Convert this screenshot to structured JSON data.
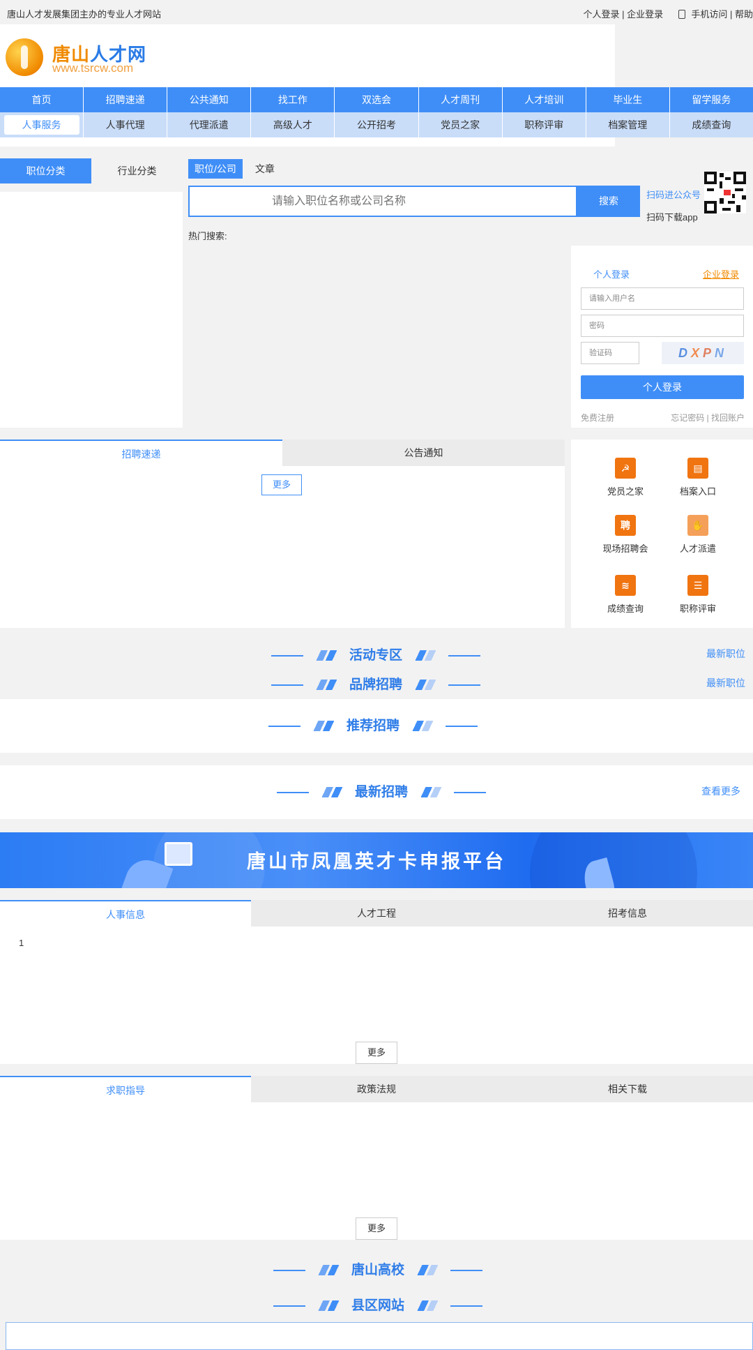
{
  "topbar": {
    "slogan": "唐山人才发展集团主办的专业人才网站",
    "links": "个人登录 | 企业登录",
    "mobile": "手机访问 | 帮助"
  },
  "logo": {
    "name_orange": "唐山",
    "name_blue": "人才",
    "name_end": "网",
    "url": "www.tsrcw.com"
  },
  "nav_primary": [
    "首页",
    "招聘速递",
    "公共通知",
    "找工作",
    "双选会",
    "人才周刊",
    "人才培训",
    "毕业生",
    "留学服务"
  ],
  "nav_secondary": [
    "人事服务",
    "人事代理",
    "代理派遣",
    "高级人才",
    "公开招考",
    "党员之家",
    "职称评审",
    "档案管理",
    "成绩查询"
  ],
  "category_tabs": [
    "职位分类",
    "行业分类"
  ],
  "search": {
    "tabs": [
      "职位/公司",
      "文章"
    ],
    "placeholder": "请输入职位名称或公司名称",
    "button": "搜索",
    "hot_label": "热门搜索:"
  },
  "qr": {
    "wechat": "扫码进公众号",
    "app": "扫码下载app"
  },
  "login": {
    "tab_personal": "个人登录",
    "tab_company": "企业登录",
    "username_placeholder": "请输入用户名",
    "password_placeholder": "密码",
    "captcha_placeholder": "验证码",
    "captcha_text": "DXPN",
    "submit": "个人登录",
    "register": "免费注册",
    "forgot": "忘记密码 | 找回账户"
  },
  "news_tabs": [
    "招聘速递",
    "公告通知"
  ],
  "news_more": "更多",
  "quick_links": [
    {
      "label": "党员之家",
      "icon": "party-icon"
    },
    {
      "label": "档案入口",
      "icon": "archive-icon"
    },
    {
      "label": "现场招聘会",
      "icon": "job-fair-icon"
    },
    {
      "label": "人才派遣",
      "icon": "handshake-icon"
    },
    {
      "label": "成绩查询",
      "icon": "score-query-icon"
    },
    {
      "label": "职称评审",
      "icon": "title-review-icon"
    }
  ],
  "sections": {
    "activity": "活动专区",
    "brand": "品牌招聘",
    "recommend": "推荐招聘",
    "latest": "最新招聘",
    "colleges": "唐山高校",
    "county": "县区网站",
    "latest_jobs_link": "最新职位",
    "see_more": "查看更多"
  },
  "banner": {
    "title": "唐山市凤凰英才卡申报平台"
  },
  "info_tabs": [
    "人事信息",
    "人才工程",
    "招考信息"
  ],
  "info_content": "1",
  "guide_tabs": [
    "求职指导",
    "政策法规",
    "相关下载"
  ],
  "more": "更多",
  "colors": {
    "primary": "#3f8ef7",
    "accent": "#f08a00"
  }
}
